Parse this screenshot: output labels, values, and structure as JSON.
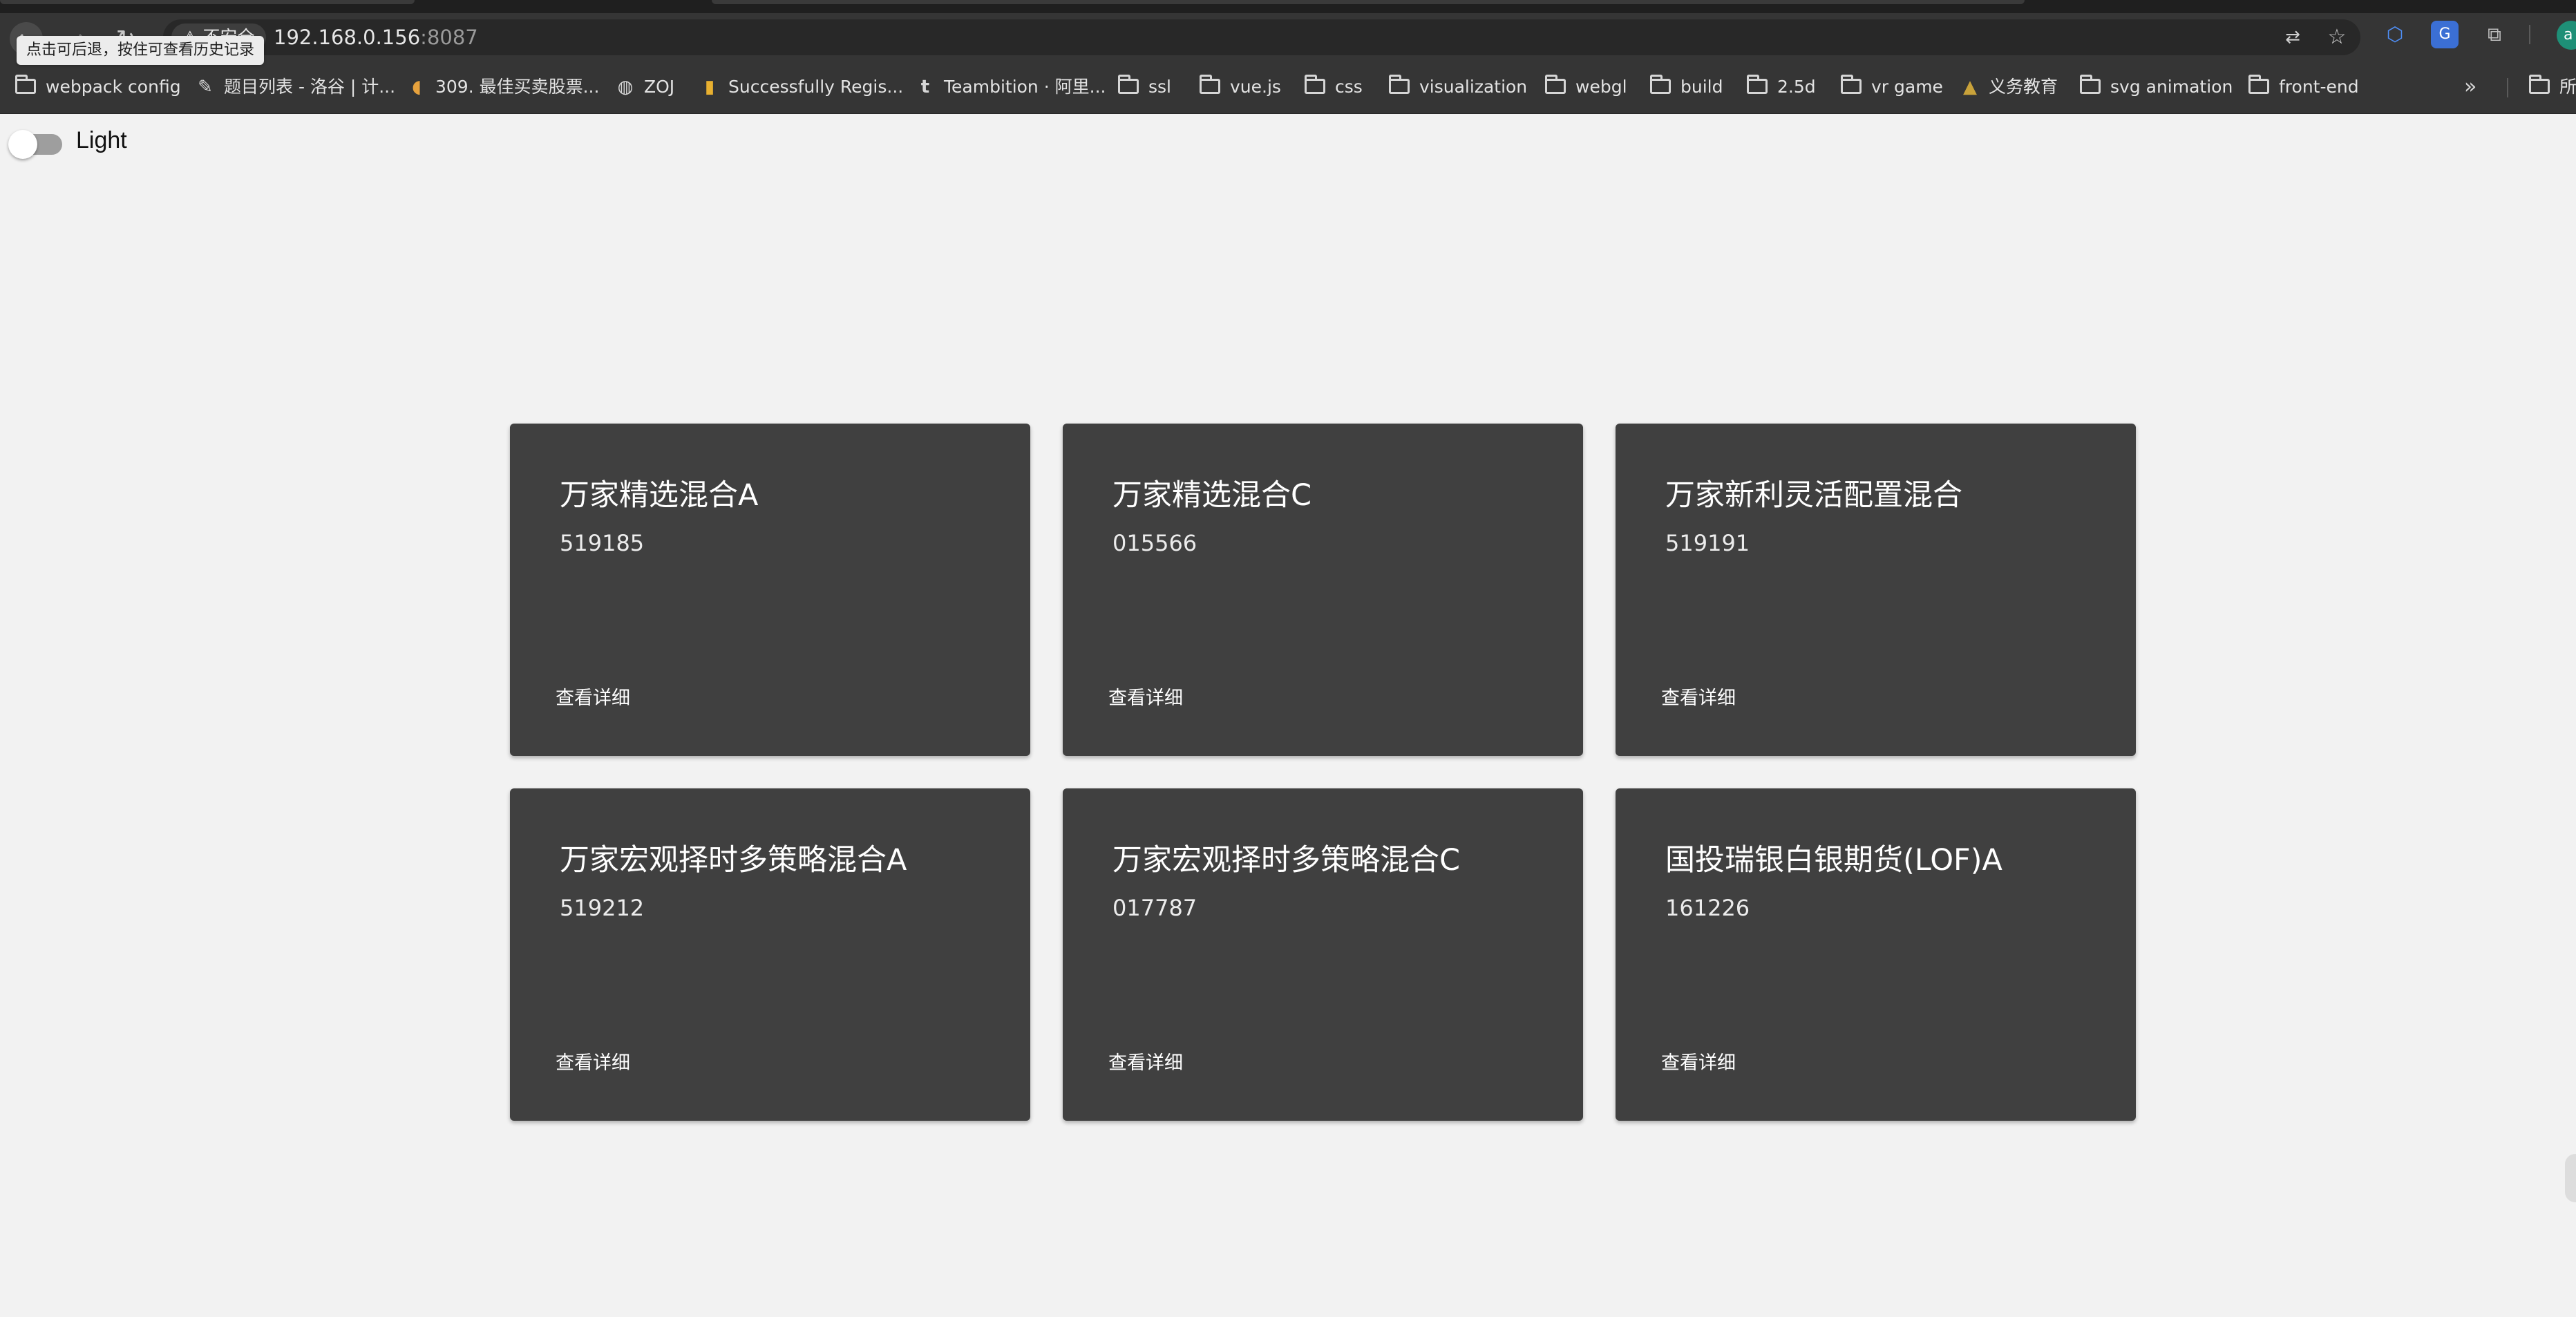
{
  "browser": {
    "security_label": "不安全",
    "url_host": "192.168.0.156",
    "url_port": ":8087",
    "back_tooltip": "点击可后退，按住可查看历史记录",
    "avatar_letter": "a"
  },
  "bookmarks": [
    {
      "label": "webpack config",
      "icon": "folder-icon"
    },
    {
      "label": "题目列表 - 洛谷 | 计...",
      "icon": "luogu-favicon"
    },
    {
      "label": "309. 最佳买卖股票...",
      "icon": "leetcode-favicon"
    },
    {
      "label": "ZOJ",
      "icon": "globe-icon"
    },
    {
      "label": "Successfully Regis...",
      "icon": "bar-chart-favicon"
    },
    {
      "label": "Teambition · 阿里...",
      "icon": "teambition-favicon"
    },
    {
      "label": "ssl",
      "icon": "folder-icon"
    },
    {
      "label": "vue.js",
      "icon": "folder-icon"
    },
    {
      "label": "css",
      "icon": "folder-icon"
    },
    {
      "label": "visualization",
      "icon": "folder-icon"
    },
    {
      "label": "webgl",
      "icon": "folder-icon"
    },
    {
      "label": "build",
      "icon": "folder-icon"
    },
    {
      "label": "2.5d",
      "icon": "folder-icon"
    },
    {
      "label": "vr game",
      "icon": "folder-icon"
    },
    {
      "label": "义务教育",
      "icon": "hat-favicon"
    },
    {
      "label": "svg animation",
      "icon": "folder-icon"
    },
    {
      "label": "front-end",
      "icon": "folder-icon"
    },
    {
      "label": "所",
      "icon": "folder-icon"
    }
  ],
  "theme_toggle": {
    "label": "Light",
    "checked": false
  },
  "funds": [
    {
      "name": "万家精选混合A",
      "code": "519185",
      "action": "查看详细"
    },
    {
      "name": "万家精选混合C",
      "code": "015566",
      "action": "查看详细"
    },
    {
      "name": "万家新利灵活配置混合",
      "code": "519191",
      "action": "查看详细"
    },
    {
      "name": "万家宏观择时多策略混合A",
      "code": "519212",
      "action": "查看详细"
    },
    {
      "name": "万家宏观择时多策略混合C",
      "code": "017787",
      "action": "查看详细"
    },
    {
      "name": "国投瑞银白银期货(LOF)A",
      "code": "161226",
      "action": "查看详细"
    }
  ],
  "colors": {
    "page_bg": "#f2f2f2",
    "card_bg": "#404040",
    "chrome_bg": "#353535"
  }
}
